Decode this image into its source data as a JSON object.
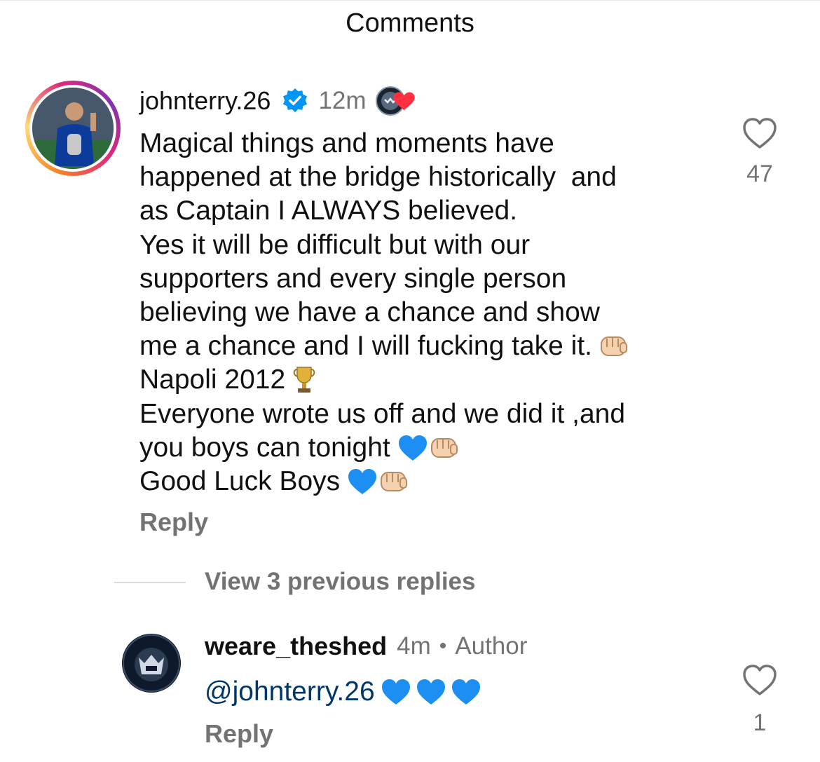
{
  "header": {
    "title": "Comments"
  },
  "main_comment": {
    "username": "johnterry.26",
    "verified": true,
    "time": "12m",
    "liked_by_author_icon": "author-avatar-with-heart",
    "lines": [
      {
        "text": "Magical things and moments have",
        "emoji": []
      },
      {
        "text": "happened at the bridge historically  and",
        "emoji": []
      },
      {
        "text": "as Captain I ALWAYS believed.",
        "emoji": []
      },
      {
        "text": "Yes it will be difficult but with our",
        "emoji": []
      },
      {
        "text": "supporters and every single person",
        "emoji": []
      },
      {
        "text": "believing we have a chance and show",
        "emoji": []
      },
      {
        "text": "me a chance and I will fucking take it.",
        "emoji": [
          "fist-icon"
        ]
      },
      {
        "text": "Napoli 2012",
        "emoji": [
          "trophy-icon"
        ]
      },
      {
        "text": "Everyone wrote us off and we did it ,and",
        "emoji": []
      },
      {
        "text": "you boys can tonight",
        "emoji": [
          "blue-heart-icon",
          "fist-icon"
        ]
      },
      {
        "text": "Good Luck Boys",
        "emoji": [
          "blue-heart-icon",
          "fist-icon"
        ]
      }
    ],
    "reply_label": "Reply",
    "like_count": "47"
  },
  "thread": {
    "view_previous_label": "View 3 previous replies"
  },
  "reply_comment": {
    "username": "weare_theshed",
    "time": "4m",
    "separator": "•",
    "author_label": "Author",
    "mention": "@johnterry.26",
    "emoji": [
      "blue-heart-icon",
      "blue-heart-icon",
      "blue-heart-icon"
    ],
    "reply_label": "Reply",
    "like_count": "1"
  },
  "colors": {
    "text": "#111111",
    "secondary": "#737373",
    "mention": "#00376b",
    "verified": "#0095f6",
    "blue_heart": "#1d8ff2",
    "heart_red": "#ff3040"
  }
}
